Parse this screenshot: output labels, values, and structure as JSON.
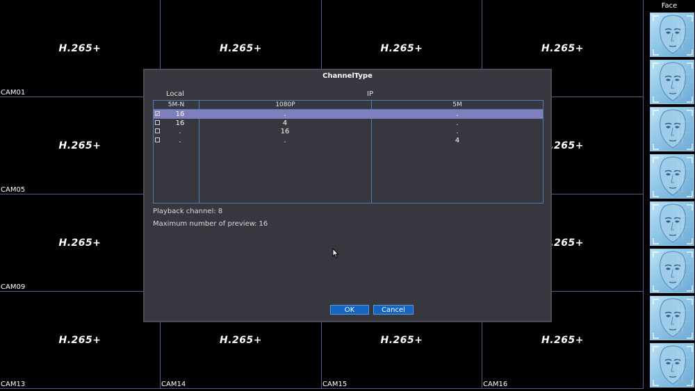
{
  "grid": {
    "logo_text": "H.265+",
    "cells": [
      {
        "label": "CAM01",
        "logo": true
      },
      {
        "label": "",
        "logo": true
      },
      {
        "label": "",
        "logo": true
      },
      {
        "label": "",
        "logo": true
      },
      {
        "label": "CAM05",
        "logo": true
      },
      {
        "label": "",
        "logo": false
      },
      {
        "label": "",
        "logo": false
      },
      {
        "label": "",
        "logo": true
      },
      {
        "label": "CAM09",
        "logo": true
      },
      {
        "label": "",
        "logo": false
      },
      {
        "label": "",
        "logo": false
      },
      {
        "label": "",
        "logo": true
      },
      {
        "label": "CAM13",
        "logo": true
      },
      {
        "label": "CAM14",
        "logo": true
      },
      {
        "label": "CAM15",
        "logo": true
      },
      {
        "label": "CAM16",
        "logo": true
      }
    ]
  },
  "sidebar": {
    "title": "Face",
    "thumbnail_count": 8,
    "thumbnail_icon": "face-snapshot-icon"
  },
  "dialog": {
    "title": "ChannelType",
    "group_local": "Local",
    "group_ip": "IP",
    "columns": [
      "5M-N",
      "1080P",
      "5M"
    ],
    "rows": [
      {
        "checked": true,
        "c1": "16",
        "c2": ".",
        "c3": "."
      },
      {
        "checked": false,
        "c1": "16",
        "c2": "4",
        "c3": "."
      },
      {
        "checked": false,
        "c1": ".",
        "c2": "16",
        "c3": "."
      },
      {
        "checked": false,
        "c1": ".",
        "c2": ".",
        "c3": "4"
      }
    ],
    "selected_row": 0,
    "playback_label": "Playback channel: 8",
    "preview_label": "Maximum number of preview",
    "preview_value": ": 16",
    "ok_label": "OK",
    "cancel_label": "Cancel"
  },
  "colors": {
    "selection": "#7f7fbe",
    "button": "#1464c0",
    "table_border": "#4f7fb3",
    "grid_line": "#5a5a8a"
  }
}
